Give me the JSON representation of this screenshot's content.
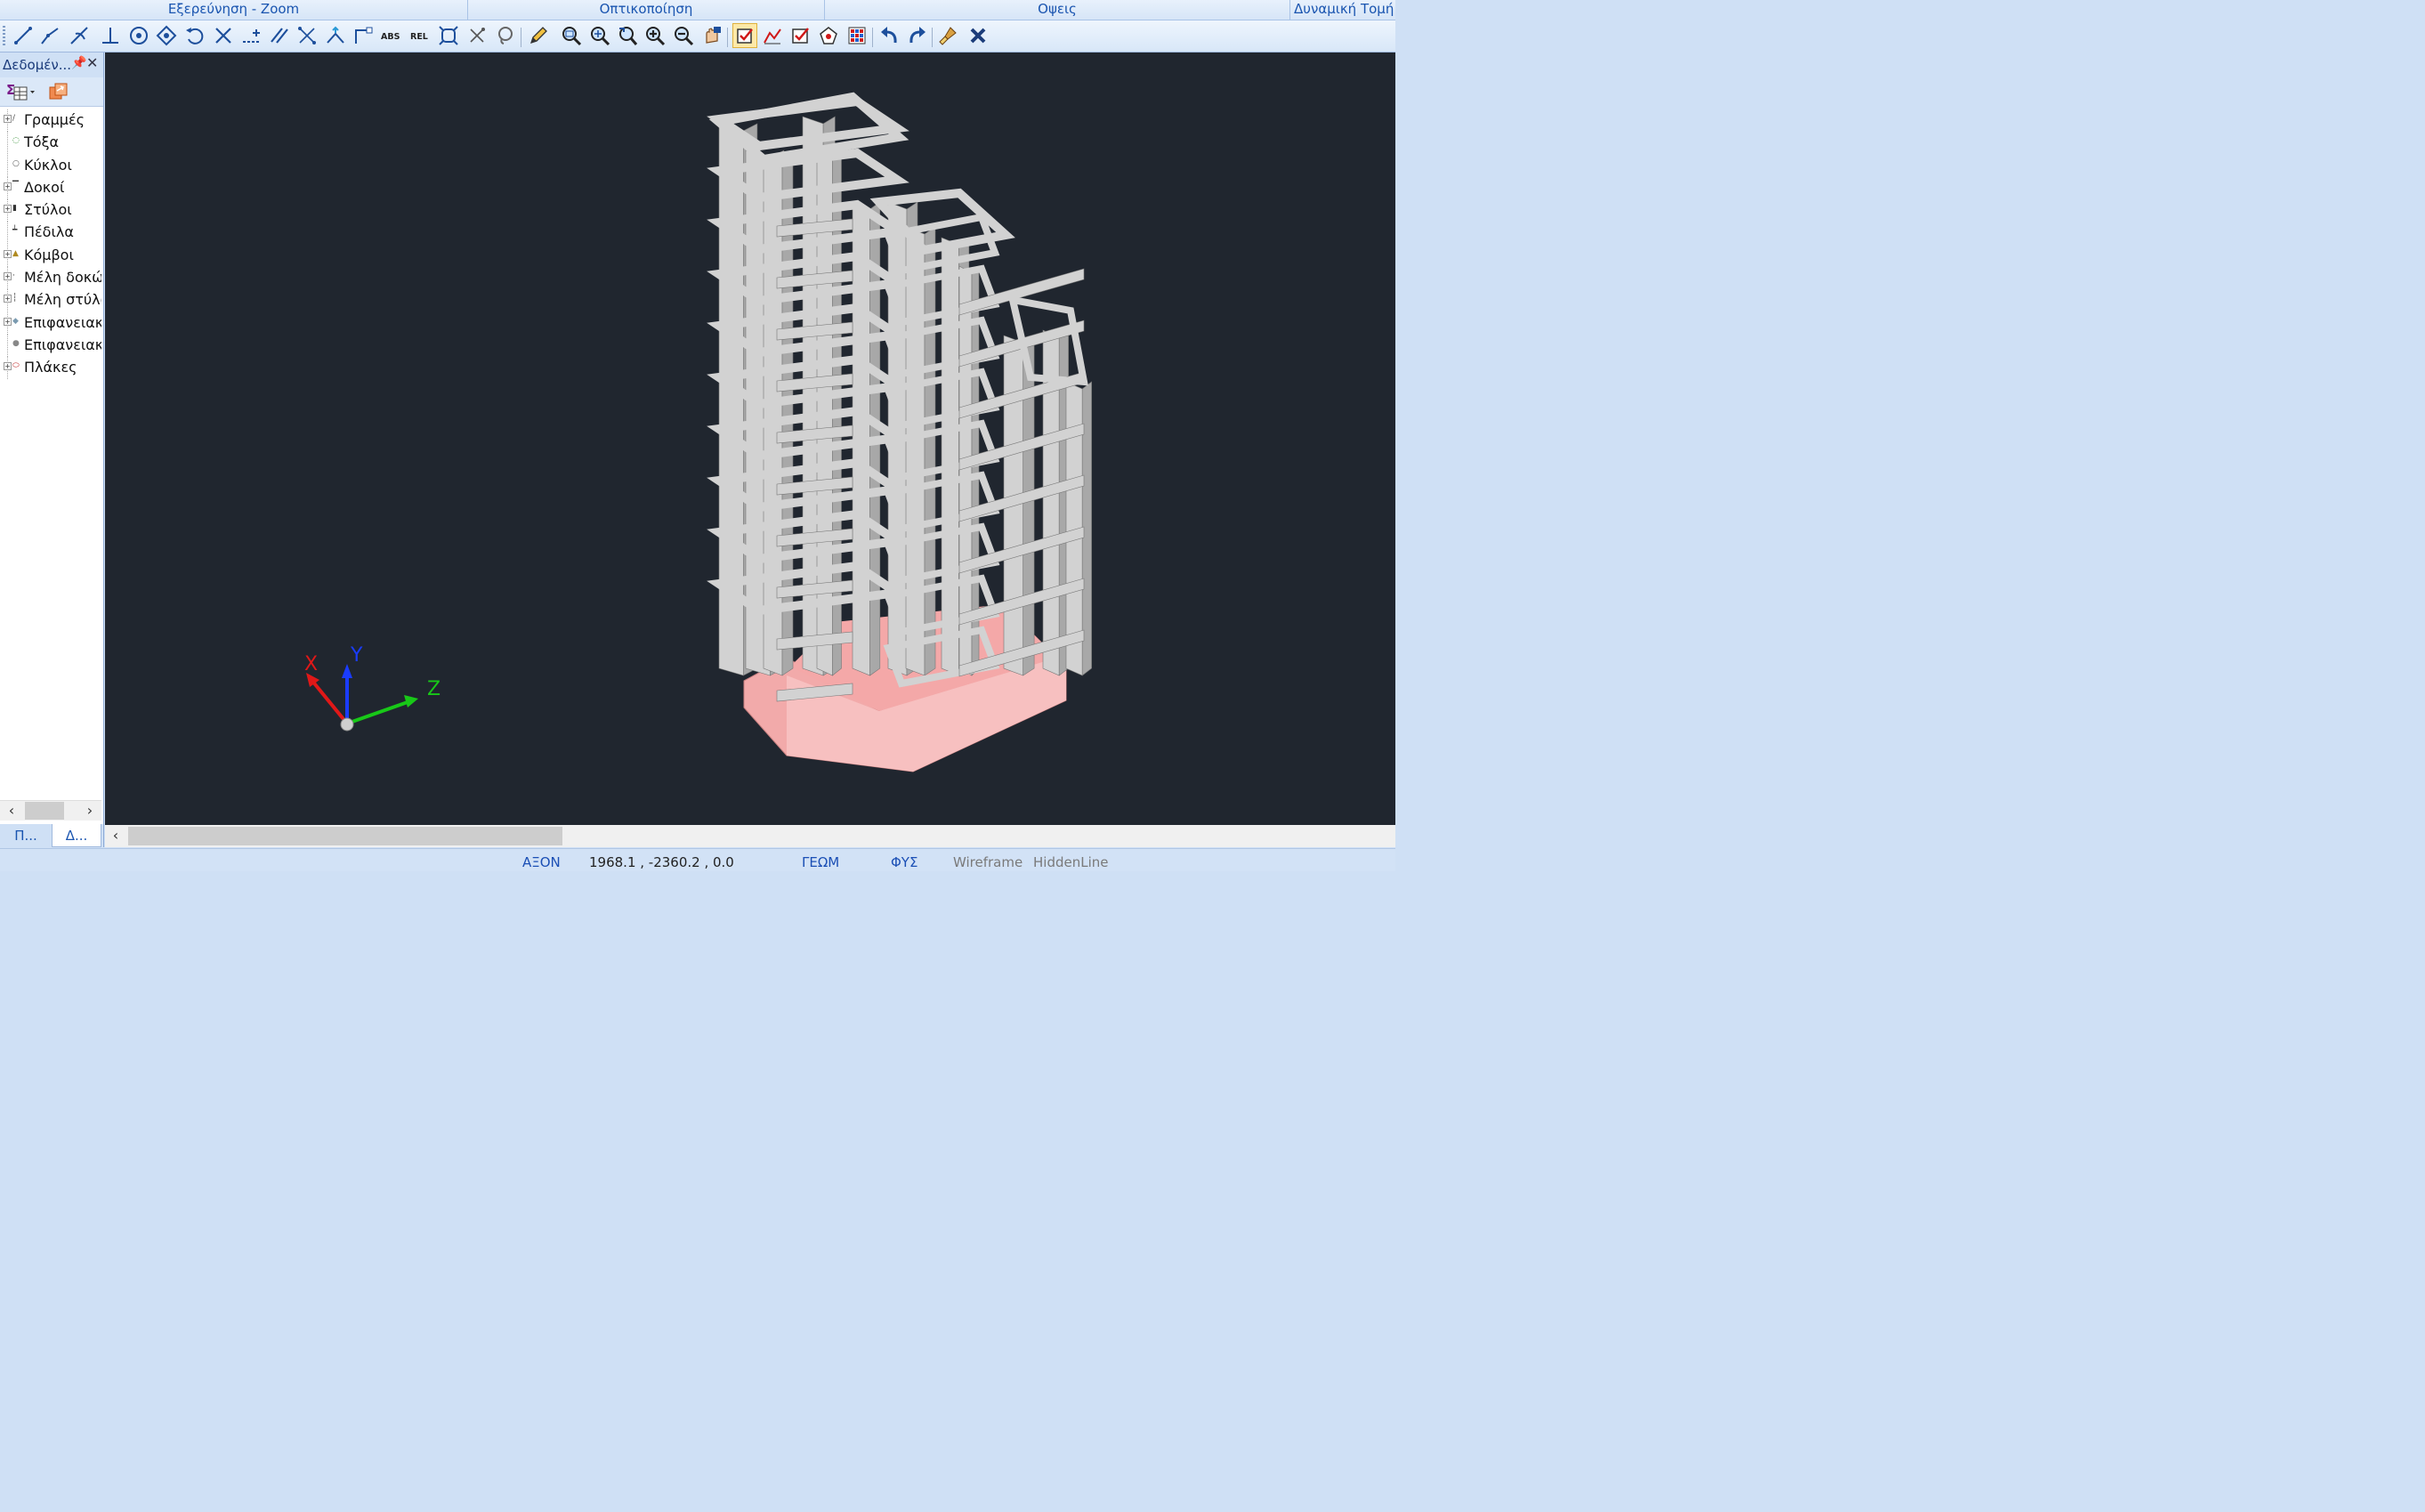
{
  "ribbon": {
    "tabs": [
      {
        "label": "Εξερεύνηση - Zoom"
      },
      {
        "label": "Οπτικοποίηση"
      },
      {
        "label": "Οψεις"
      },
      {
        "label": "Δυναμική Τομή"
      }
    ]
  },
  "toolbar": {
    "icons": [
      "line-icon",
      "polyline-icon",
      "trim-line-icon",
      "perpendicular-icon",
      "circle-icon",
      "snap-node-icon",
      "rotate-icon",
      "intersect-icon",
      "baseline-icon",
      "parallel-icon",
      "cross-icon",
      "move-node-icon",
      "corner-icon",
      "abs-coords-icon",
      "rel-coords-icon",
      "fit-icon",
      "delete-icon",
      "lasso-icon",
      "edit-pencil-icon",
      "zoom-window-icon",
      "zoom-extent-icon",
      "zoom-previous-icon",
      "zoom-in-icon",
      "zoom-out-icon",
      "pan-icon",
      "toggle-check-icon",
      "graph-icon",
      "check-list-icon",
      "polygon-icon",
      "grid-color-icon",
      "undo-icon",
      "redo-icon",
      "clean-brush-icon",
      "close-x-icon"
    ],
    "active_icon": "toggle-check-icon",
    "abs_label": "ABS",
    "rel_label": "REL"
  },
  "left_panel": {
    "title": "Δεδομέν...",
    "tree": [
      {
        "label": "Γραμμές",
        "expandable": true,
        "icon": "line-type-icon"
      },
      {
        "label": "Τόξα",
        "expandable": false,
        "icon": "arc-type-icon"
      },
      {
        "label": "Κύκλοι",
        "expandable": false,
        "icon": "circle-type-icon"
      },
      {
        "label": "Δοκοί",
        "expandable": true,
        "icon": "beam-type-icon"
      },
      {
        "label": "Στύλοι",
        "expandable": true,
        "icon": "column-type-icon"
      },
      {
        "label": "Πέδιλα",
        "expandable": false,
        "icon": "footing-type-icon"
      },
      {
        "label": "Κόμβοι",
        "expandable": true,
        "icon": "node-type-icon"
      },
      {
        "label": "Μέλη δοκών",
        "expandable": true,
        "icon": "beam-member-icon"
      },
      {
        "label": "Μέλη στύλων",
        "expandable": true,
        "icon": "column-member-icon"
      },
      {
        "label": "Επιφανειακά",
        "expandable": true,
        "icon": "surface-icon"
      },
      {
        "label": "Επιφανειακά",
        "expandable": false,
        "icon": "surface-shell-icon"
      },
      {
        "label": "Πλάκες",
        "expandable": true,
        "icon": "slab-type-icon"
      }
    ],
    "bottom_tabs": [
      {
        "label": "Π..."
      },
      {
        "label": "Δ..."
      }
    ]
  },
  "viewport": {
    "background": "#20262f",
    "axes": {
      "x_label": "X",
      "y_label": "Y",
      "z_label": "Z",
      "x_color": "#e01818",
      "y_color": "#1a3cff",
      "z_color": "#18c818"
    },
    "model_colors": {
      "frame": "#a8a8a8",
      "frame_light": "#d2d2d2",
      "foundation": "#f2aaaa"
    }
  },
  "status": {
    "axis_mode": "ΑΞΟΝ",
    "coords": "1968.1 , -2360.2 , 0.0",
    "geom": "ΓΕΩΜ",
    "phys": "ΦΥΣ",
    "wireframe": "Wireframe",
    "hiddenline": "HiddenLine"
  }
}
